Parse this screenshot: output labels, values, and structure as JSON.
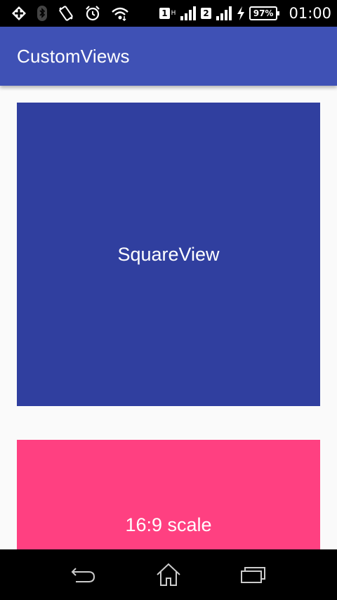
{
  "status_bar": {
    "sim1_label": "1",
    "sim1_network": "H",
    "sim2_label": "2",
    "battery_percent": "97%",
    "time": "01:00",
    "icons": [
      "add-icon",
      "bluetooth-icon",
      "vibrate-icon",
      "alarm-icon",
      "wifi-icon",
      "sim-card-icon",
      "signal-icon",
      "charging-icon",
      "battery-icon"
    ]
  },
  "app_bar": {
    "title": "CustomViews",
    "color": "#3f51b5"
  },
  "content": {
    "square_view": {
      "label": "SquareView",
      "color": "#303f9f"
    },
    "ratio_view": {
      "label": "16:9 scale",
      "color": "#ff4081"
    }
  },
  "nav_bar": {
    "buttons": [
      "back-icon",
      "home-icon",
      "recents-icon"
    ]
  }
}
